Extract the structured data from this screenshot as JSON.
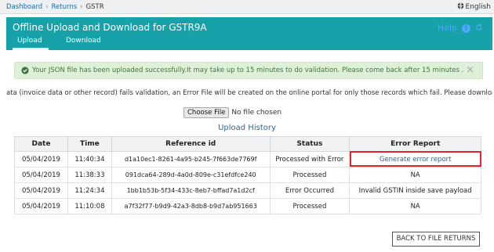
{
  "breadcrumb": {
    "items": [
      "Dashboard",
      "Returns"
    ],
    "current": "GSTR"
  },
  "language": {
    "label": "English",
    "icon": "globe-icon"
  },
  "header": {
    "title": "Offline Upload and Download for GSTR9A",
    "help_label": "Help",
    "help_icon": "question-icon",
    "refresh_icon": "refresh-icon",
    "color": "#17a1a8"
  },
  "tabs": [
    {
      "label": "Upload",
      "active": true
    },
    {
      "label": "Download",
      "active": false
    }
  ],
  "alert": {
    "icon": "check-circle-icon",
    "text": "Your JSON file has been uploaded successfully.It may take up to 15 minutes to do validation. Please come back after 15 minutes .",
    "close": "×",
    "color": "#3c763d"
  },
  "info_text": "ata (invoice data or other record) fails validation, an Error File will be created on the online portal for only those records which fail. Please download the erro",
  "file_input": {
    "button_label": "Choose File",
    "status": "No file chosen"
  },
  "history": {
    "title": "Upload History",
    "columns": [
      "Date",
      "Time",
      "Reference id",
      "Status",
      "Error Report"
    ],
    "rows": [
      {
        "date": "05/04/2019",
        "time": "11:40:34",
        "ref": "d1a10ec1-8261-4a95-b245-7f663de7769f",
        "status": "Processed with Error",
        "report": "Generate error report"
      },
      {
        "date": "05/04/2019",
        "time": "11:38:33",
        "ref": "091dca64-289d-4a0d-809e-c31efdfce240",
        "status": "Processed",
        "report": "NA"
      },
      {
        "date": "05/04/2019",
        "time": "11:24:34",
        "ref": "1bb1b53b-5f34-433c-8eb7-bffad7a1d2cf",
        "status": "Error Occurred",
        "report": "Invalid GSTIN inside save payload"
      },
      {
        "date": "05/04/2019",
        "time": "11:10:08",
        "ref": "a7f32f77-b9d9-42a3-8db8-b9d7ab951663",
        "status": "Processed",
        "report": "NA"
      }
    ]
  },
  "back_button": "BACK TO FILE RETURNS",
  "highlight_color": "#e4232c"
}
